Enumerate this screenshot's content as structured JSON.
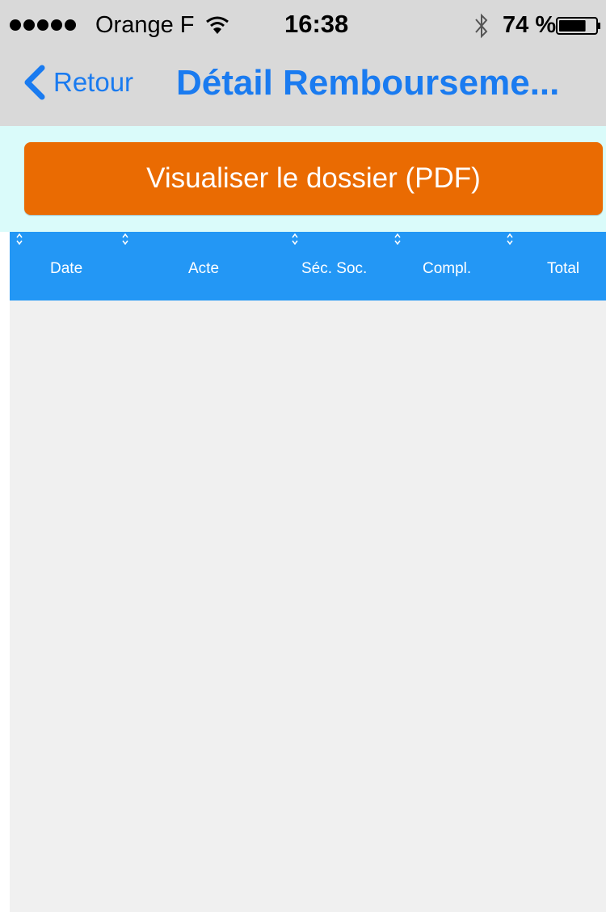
{
  "status_bar": {
    "carrier": "Orange F",
    "time": "16:38",
    "battery_percent": "74 %",
    "battery_level": 0.74
  },
  "nav": {
    "back_label": "Retour",
    "title": "Détail Rembourseme..."
  },
  "pdf_button_label": "Visualiser le dossier (PDF)",
  "table": {
    "columns": [
      "Date",
      "Acte",
      "Séc. Soc.",
      "Compl.",
      "Total"
    ]
  },
  "colors": {
    "accent": "#1a7bf0",
    "button": "#ea6b02",
    "header": "#2397f5",
    "pdf_area": "#dafbfa"
  },
  "icons": [
    "signal-dots-icon",
    "wifi-icon",
    "bluetooth-icon",
    "battery-icon",
    "chevron-left-icon",
    "sort-icon"
  ]
}
